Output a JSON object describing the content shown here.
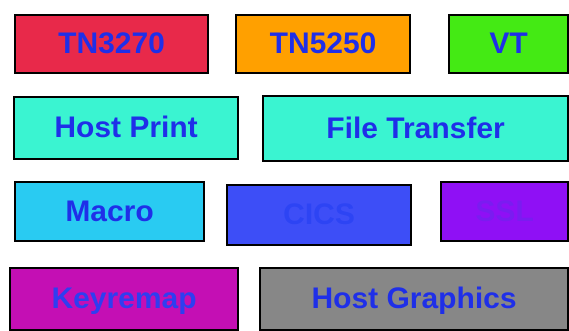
{
  "tiles": [
    {
      "label": "TN3270",
      "background": "#e8294a",
      "text_color": "#1f2fe8"
    },
    {
      "label": "TN5250",
      "background": "#ffa000",
      "text_color": "#1f2fe8"
    },
    {
      "label": "VT",
      "background": "#44ea14",
      "text_color": "#1f2fe8"
    },
    {
      "label": "Host Print",
      "background": "#3af4d1",
      "text_color": "#1f2fe8"
    },
    {
      "label": "File Transfer",
      "background": "#3af4d1",
      "text_color": "#1f2fe8"
    },
    {
      "label": "Macro",
      "background": "#29cbf2",
      "text_color": "#1f2fe8"
    },
    {
      "label": "CICS",
      "background": "#3d4ef7",
      "text_color": "#2d44f4"
    },
    {
      "label": "SSL",
      "background": "#8f10f5",
      "text_color": "#7a1cf0"
    },
    {
      "label": "Keyremap",
      "background": "#c40fb4",
      "text_color": "#2f3ef0"
    },
    {
      "label": "Host Graphics",
      "background": "#878787",
      "text_color": "#1f2fe8"
    }
  ]
}
